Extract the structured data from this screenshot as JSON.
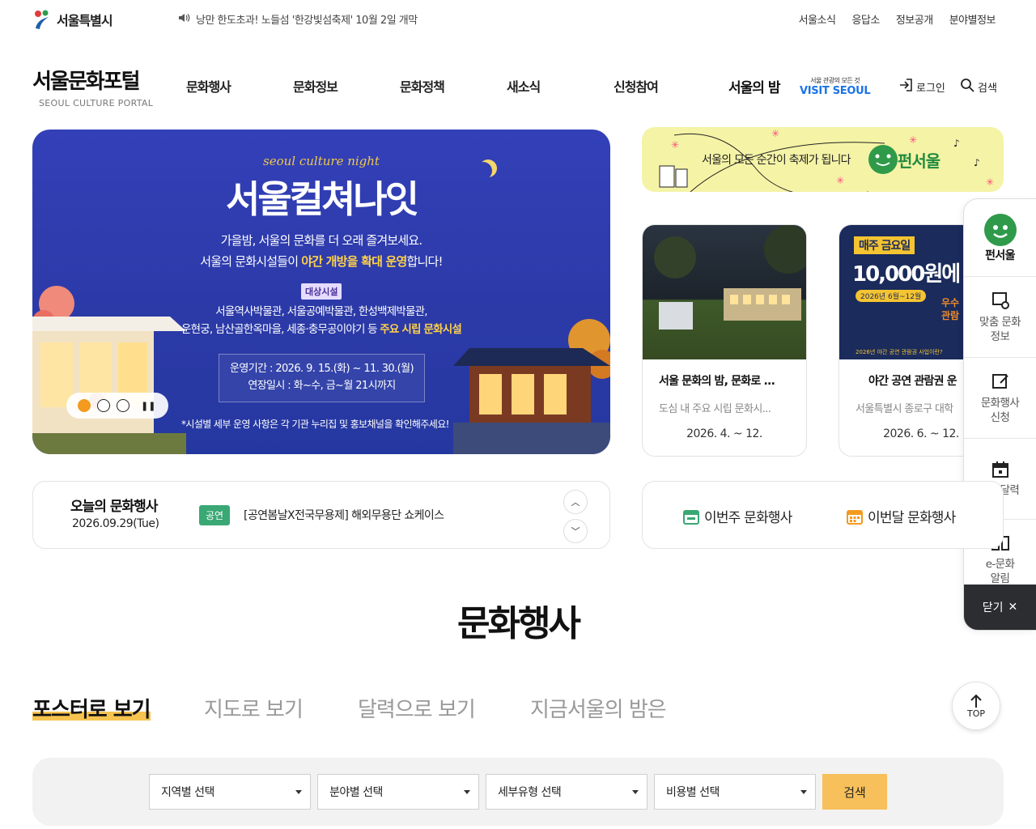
{
  "top": {
    "seoul_logo_text": "서울특별시",
    "notice": "낭만 한도초과! 노들섬 '한강빛섬축제' 10월 2일 개막",
    "util_nav": [
      "서울소식",
      "응답소",
      "정보공개",
      "분야별정보"
    ]
  },
  "header": {
    "logo_ko": "서울문화포털",
    "logo_en": "SEOUL CULTURE PORTAL",
    "gnb": [
      "문화행사",
      "문화정보",
      "문화정책",
      "새소식",
      "신청참여"
    ],
    "night_link": "서울의 밤",
    "visit_small": "서울 관광의 모든 것",
    "visit_big": "VISIT SEOUL",
    "login": "로그인",
    "search": "검색"
  },
  "hero": {
    "subtitle": "seoul culture night",
    "title": "서울컬쳐나잇",
    "line1": "가을밤, 서울의 문화를 더 오래 즐겨보세요.",
    "line2_a": "서울의 문화시설들이 ",
    "line2_hl": "야간 개방을 확대 운영",
    "line2_b": "합니다!",
    "target_badge": "대상시설",
    "fac1": "서울역사박물관, 서울공예박물관, 한성백제박물관,",
    "fac2_a": "운현궁, 남산골한옥마을, 세종·충무공이야기 등 ",
    "fac2_hl": "주요 시립 문화시설",
    "period1": "운영기간 : 2026. 9. 15.(화) ~ 11. 30.(월)",
    "period2": "연장일시 : 화~수, 금~월 21시까지",
    "footnote": "*시설별 세부 운영 사항은 각 기관 누리집 및 홍보채널을 확인해주세요!"
  },
  "ad": {
    "message": "서울의 모든 순간이 축제가 됩니다",
    "brand": "펀서울"
  },
  "cards": [
    {
      "title": "서울 문화의 밤, 문화로 ...",
      "desc": "도심 내 주요 시립 문화시...",
      "date": "2026. 4. ~ 12."
    },
    {
      "title": "야간 공연 관람권 운",
      "desc": "서울특별시 종로구 대학",
      "date": "2026. 6. ~ 12.",
      "img_title": "매주 금요일",
      "img_price": "10,000원에",
      "img_period": "2026년 6월~12월",
      "img_side": "우수 관람",
      "img_foot": "2026년 야간 공연 관람권 사업이란?"
    }
  ],
  "quick_menu": {
    "brand": "펀서울",
    "items": [
      "맞춤 문화정보",
      "문화행사 신청",
      "문화달력",
      "e-문화 알림"
    ],
    "close": "닫기"
  },
  "today": {
    "heading": "오늘의 문화행사",
    "date": "2026.09.29(Tue)",
    "category": "공연",
    "event": "[공연봄날X전국무용제] 해외무용단 쇼케이스"
  },
  "period_links": [
    "이번주 문화행사",
    "이번달 문화행사"
  ],
  "section": {
    "title": "문화행사",
    "tabs": [
      "포스터로 보기",
      "지도로 보기",
      "달력으로 보기",
      "지금서울의 밤은"
    ],
    "top_label": "TOP"
  },
  "filters": {
    "selects": [
      "지역별 선택",
      "분야별 선택",
      "세부유형 선택",
      "비용별 선택"
    ],
    "search_label": "검색"
  },
  "colors": {
    "hero_bg": "#2c3aa8",
    "accent_orange": "#f39a1f",
    "search_yellow": "#f7c05a",
    "category_green": "#3aa874",
    "fun_seoul_green": "#1f8a3e"
  }
}
